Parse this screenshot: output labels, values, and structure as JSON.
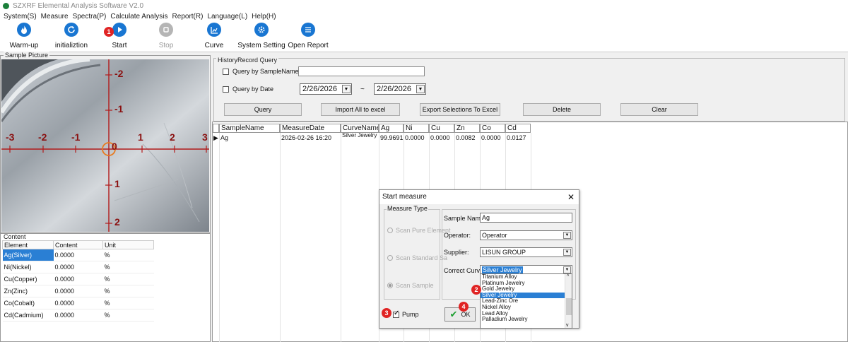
{
  "window": {
    "title": "SZXRF Elemental Analysis Software V2.0"
  },
  "menu": [
    "System(S)",
    "Measure",
    "Spectra(P)",
    "Calculate Analysis",
    "Report(R)",
    "Language(L)",
    "Help(H)"
  ],
  "toolbar": {
    "warmup": "Warm-up",
    "init": "initializtion",
    "start": "Start",
    "stop": "Stop",
    "curve": "Curve",
    "system_setting": "System Setting",
    "open_report": "Open Report"
  },
  "badges": {
    "b1": "1",
    "b2": "2",
    "b3": "3",
    "b4": "4"
  },
  "sample_picture": {
    "title": "Sample Picture",
    "labels_x": [
      "-3",
      "-2",
      "-1",
      "0",
      "1",
      "2",
      "3"
    ],
    "labels_y": [
      "-2",
      "-1",
      "0",
      "1",
      "2"
    ]
  },
  "content": {
    "title": "Content",
    "headers": [
      "Element",
      "Content",
      "Unit"
    ],
    "rows": [
      [
        "Ag(Silver)",
        "0.0000",
        "%"
      ],
      [
        "Ni(Nickel)",
        "0.0000",
        "%"
      ],
      [
        "Cu(Copper)",
        "0.0000",
        "%"
      ],
      [
        "Zn(Zinc)",
        "0.0000",
        "%"
      ],
      [
        "Co(Cobalt)",
        "0.0000",
        "%"
      ],
      [
        "Cd(Cadmium)",
        "0.0000",
        "%"
      ]
    ]
  },
  "history": {
    "title": "HistoryRecord Query",
    "by_name": "Query by SampleName",
    "by_date": "Query by Date",
    "date_from": "2/26/2026",
    "date_to": "2/26/2026",
    "tilde": "~",
    "buttons": {
      "query": "Query",
      "import": "Import All to excel",
      "export": "Export Selections To Excel",
      "delete": "Delete",
      "clear": "Clear"
    }
  },
  "grid": {
    "headers": [
      "SampleName",
      "MeasureDate",
      "CurveName",
      "Ag",
      "Ni",
      "Cu",
      "Zn",
      "Co",
      "Cd"
    ],
    "rows": [
      [
        "Ag",
        "2026-02-26 16:20",
        "Silver Jewelry",
        "99.9691",
        "0.0000",
        "0.0000",
        "0.0082",
        "0.0000",
        "0.0127"
      ]
    ]
  },
  "dialog": {
    "title": "Start measure",
    "close": "✕",
    "measure_type": "Measure Type",
    "radios": [
      "Scan Pure Element",
      "Scan Standard Sa",
      "Scan Sample"
    ],
    "sample_name_label": "Sample Name:",
    "sample_name": "Ag",
    "operator_label": "Operator:",
    "operator": "Operator",
    "supplier_label": "Supplier:",
    "supplier": "LISUN GROUP",
    "curve_label": "Correct Curve:",
    "curve": "Silver Jewelry",
    "curve_options": [
      "Titanium Alloy",
      "Platinum Jewelry",
      "Gold Jewelry",
      "Silver Jewelry",
      "Lead-Zinc Ore",
      "Nickel Alloy",
      "Lead Alloy",
      "Palladium Jewelry"
    ],
    "pump": "Pump",
    "ok": "OK"
  },
  "colors": {
    "accent": "#1976d2",
    "selection": "#2a7fd4",
    "badge": "#e02424",
    "crosshair": "#b21a1a",
    "ring": "#e87a1e"
  }
}
